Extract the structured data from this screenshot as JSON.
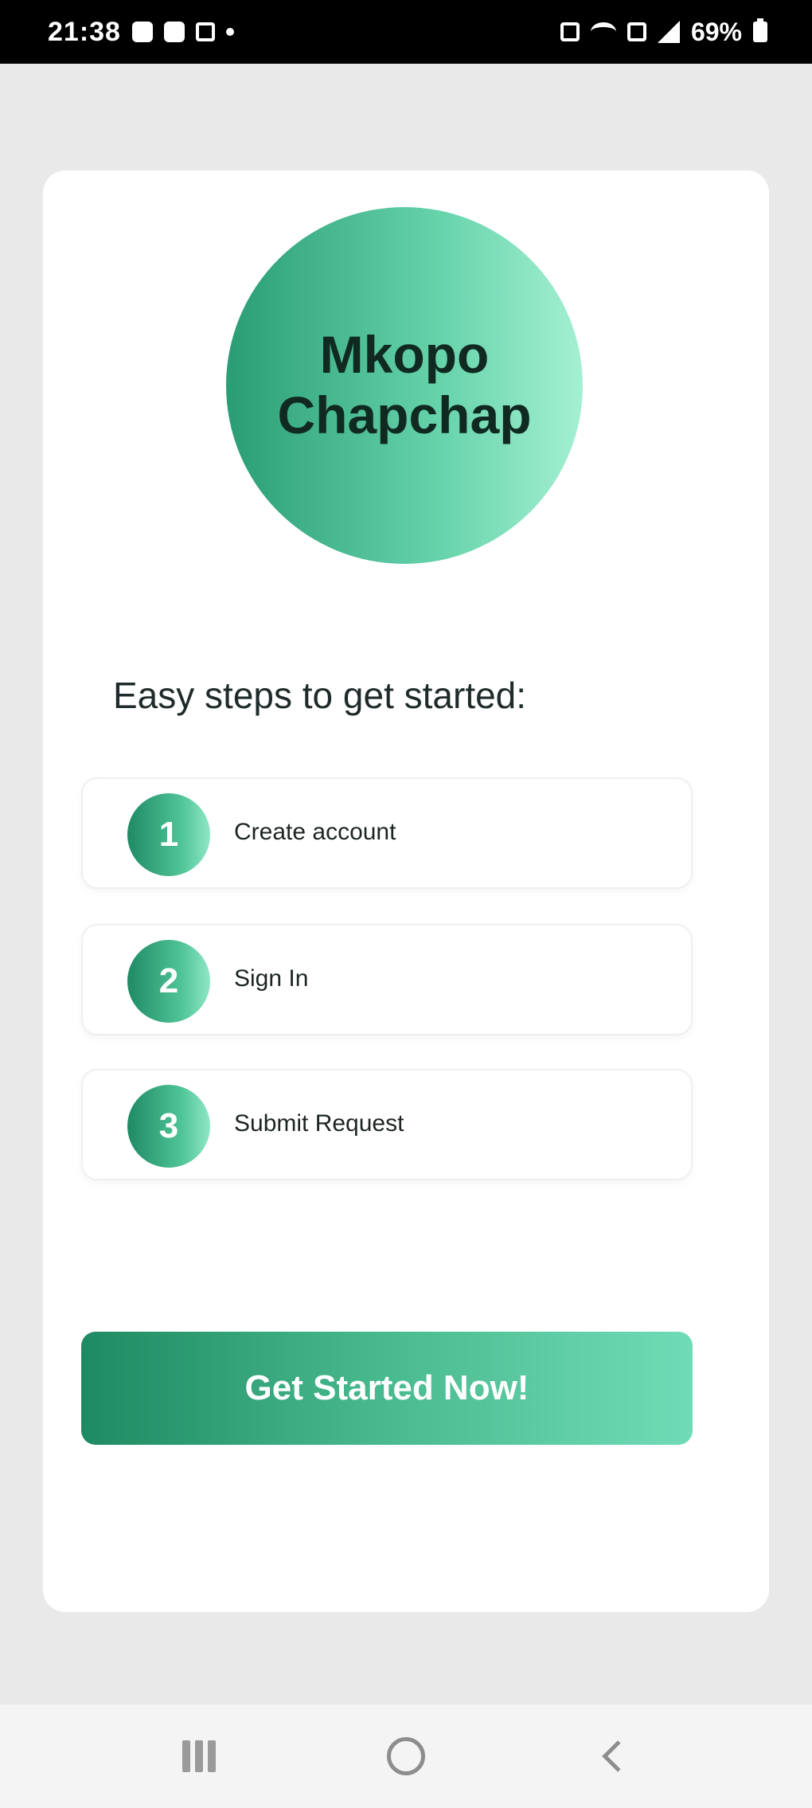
{
  "status_bar": {
    "time": "21:38",
    "battery": "69%"
  },
  "logo": {
    "line1": "Mkopo",
    "line2": "Chapchap"
  },
  "steps": {
    "heading": "Easy steps to get started:",
    "items": [
      {
        "number": "1",
        "label": "Create account"
      },
      {
        "number": "2",
        "label": "Sign In"
      },
      {
        "number": "3",
        "label": "Submit Request"
      }
    ]
  },
  "cta": {
    "label": "Get Started Now!"
  },
  "colors": {
    "accent_dark": "#1e8a63",
    "accent_light": "#70dcb7",
    "background": "#e9e9e9",
    "card": "#ffffff"
  },
  "icons": {
    "nav_recents": "recents-icon",
    "nav_home": "home-icon",
    "nav_back": "back-icon"
  }
}
